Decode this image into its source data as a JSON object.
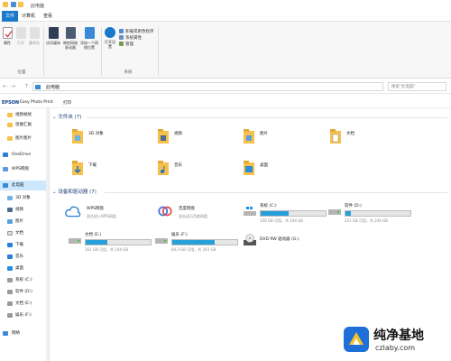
{
  "window": {
    "title": "此电脑"
  },
  "tabs": [
    {
      "label": "文件",
      "active": true
    },
    {
      "label": "计算机",
      "active": false
    },
    {
      "label": "查看",
      "active": false
    }
  ],
  "ribbon": {
    "location_group": {
      "label": "位置",
      "properties": "属性",
      "open": "打开",
      "rename": "重命名"
    },
    "network_group": {
      "access_media": "访问媒体",
      "map_drive": "映射网络驱动器",
      "add_location": "添加一个网络位置"
    },
    "system_group": {
      "label": "系统",
      "open_settings": "打开设置",
      "uninstall": "卸载或更改程序",
      "system_props": "系统属性",
      "manage": "管理"
    }
  },
  "address": {
    "back": "←",
    "forward": "→",
    "up": "↑",
    "path": "此电脑",
    "search_placeholder": "搜索\"此电脑\""
  },
  "epson": {
    "brand": "EPSON",
    "app": "Easy Photo Print",
    "print": "打印"
  },
  "sidebar": {
    "items": [
      {
        "label": "视频帧帧",
        "icon": "folder-icon"
      },
      {
        "label": "思维汇报",
        "icon": "folder-icon"
      },
      {
        "label": "图片图片",
        "icon": "folder-icon"
      },
      {
        "label": "OneDrive",
        "icon": "cloud-icon"
      },
      {
        "label": "WPS网盘",
        "icon": "cloud-icon"
      },
      {
        "label": "此电脑",
        "icon": "computer-icon",
        "selected": true
      },
      {
        "label": "3D 对象",
        "icon": "cube-icon"
      },
      {
        "label": "视频",
        "icon": "video-icon"
      },
      {
        "label": "图片",
        "icon": "picture-icon"
      },
      {
        "label": "文档",
        "icon": "document-icon"
      },
      {
        "label": "下载",
        "icon": "download-icon"
      },
      {
        "label": "音乐",
        "icon": "music-icon"
      },
      {
        "label": "桌面",
        "icon": "desktop-icon"
      },
      {
        "label": "系统 (C:)",
        "icon": "drive-icon"
      },
      {
        "label": "软件 (D:)",
        "icon": "drive-icon"
      },
      {
        "label": "文档 (E:)",
        "icon": "drive-icon"
      },
      {
        "label": "娱乐 (F:)",
        "icon": "drive-icon"
      },
      {
        "label": "网络",
        "icon": "network-icon"
      }
    ]
  },
  "folders_section": {
    "title": "文件夹 (7)",
    "items": [
      {
        "name": "3D 对象",
        "icon": "3d-objects-folder-icon"
      },
      {
        "name": "视频",
        "icon": "videos-folder-icon"
      },
      {
        "name": "图片",
        "icon": "pictures-folder-icon"
      },
      {
        "name": "文档",
        "icon": "documents-folder-icon"
      },
      {
        "name": "下载",
        "icon": "downloads-folder-icon"
      },
      {
        "name": "音乐",
        "icon": "music-folder-icon"
      },
      {
        "name": "桌面",
        "icon": "desktop-folder-icon"
      }
    ]
  },
  "devices_section": {
    "title": "设备和驱动器 (7)",
    "items": [
      {
        "name": "WPS网盘",
        "sub": "双击进入WPS网盘",
        "type": "cloud"
      },
      {
        "name": "百度网盘",
        "sub": "双击运行百度网盘",
        "type": "cloud"
      },
      {
        "name": "系统 (C:)",
        "free": "140 GB 可用，共 244 GB",
        "used_fraction": 0.43,
        "type": "drive"
      },
      {
        "name": "软件 (D:)",
        "free": "221 GB 可用，共 244 GB",
        "used_fraction": 0.09,
        "type": "drive"
      },
      {
        "name": "文档 (E:)",
        "free": "161 GB 可用，共 244 GB",
        "used_fraction": 0.34,
        "type": "drive"
      },
      {
        "name": "娱乐 (F:)",
        "free": "84.3 GB 可用，共 243 GB",
        "used_fraction": 0.65,
        "type": "drive"
      },
      {
        "name": "DVD RW 驱动器 (G:)",
        "type": "dvd"
      }
    ]
  },
  "watermark": {
    "text": "纯净基地",
    "domain": "czlaby.com"
  },
  "colors": {
    "accent": "#1979ca",
    "folder": "#f6c04a",
    "bar": "#26a0da",
    "section": "#1e3d78"
  }
}
